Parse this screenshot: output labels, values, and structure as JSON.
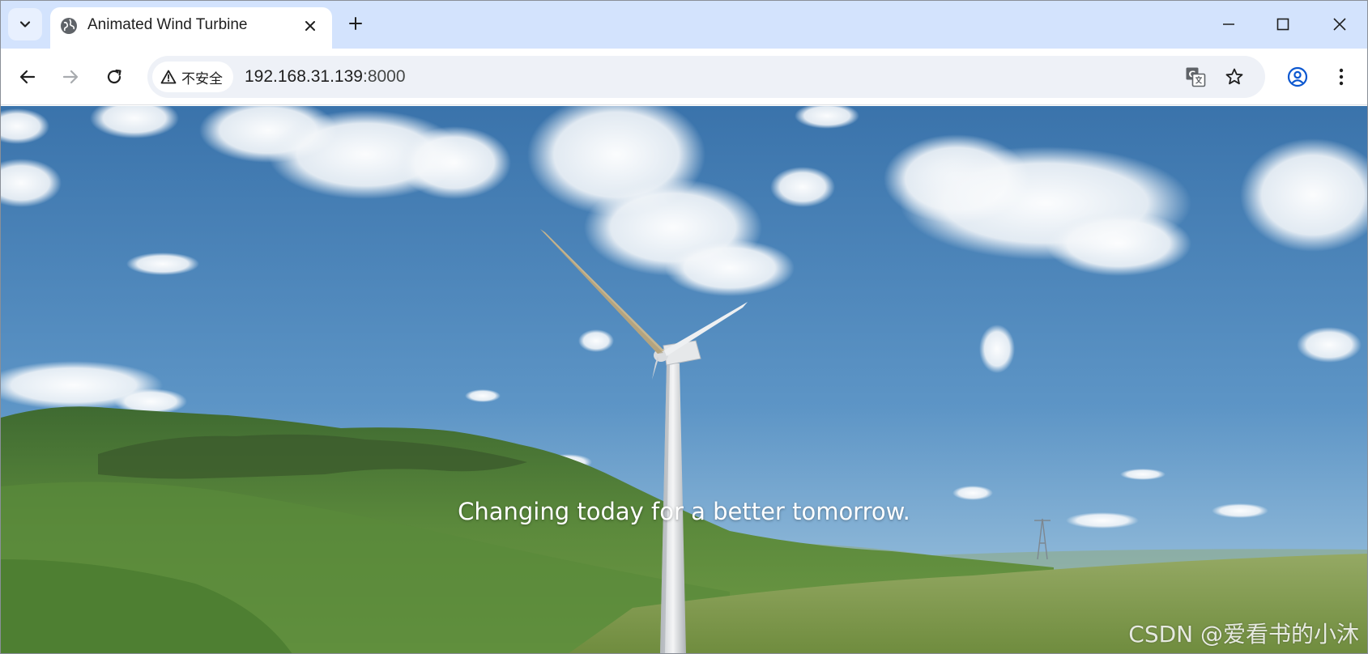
{
  "browser": {
    "tab": {
      "title": "Animated Wind Turbine",
      "favicon": "globe-icon"
    },
    "tab_strip": {
      "search_icon": "chevron-down-icon",
      "close_icon": "close-icon",
      "new_tab_icon": "plus-icon"
    },
    "window_controls": [
      "minimize-icon",
      "maximize-icon",
      "close-icon"
    ],
    "toolbar": {
      "back_icon": "arrow-left-icon",
      "forward_icon": "arrow-right-icon",
      "reload_icon": "reload-icon",
      "security_label": "不安全",
      "url_host": "192.168.31.139",
      "url_port": ":8000",
      "translate_icon": "translate-icon",
      "bookmark_icon": "star-icon",
      "profile_icon": "profile-icon",
      "menu_icon": "kebab-menu-icon"
    }
  },
  "page": {
    "tagline": "Changing today for a better tomorrow.",
    "watermark": "CSDN @爱看书的小沐"
  },
  "colors": {
    "tab_strip": "#d3e3fd",
    "omnibox": "#eef1f7",
    "profile_accent": "#0b57d0",
    "sky_top": "#3e78b0",
    "sky_bottom": "#9cc4e0",
    "hills": "#4a7a34",
    "grass": "#7f9d4a"
  }
}
